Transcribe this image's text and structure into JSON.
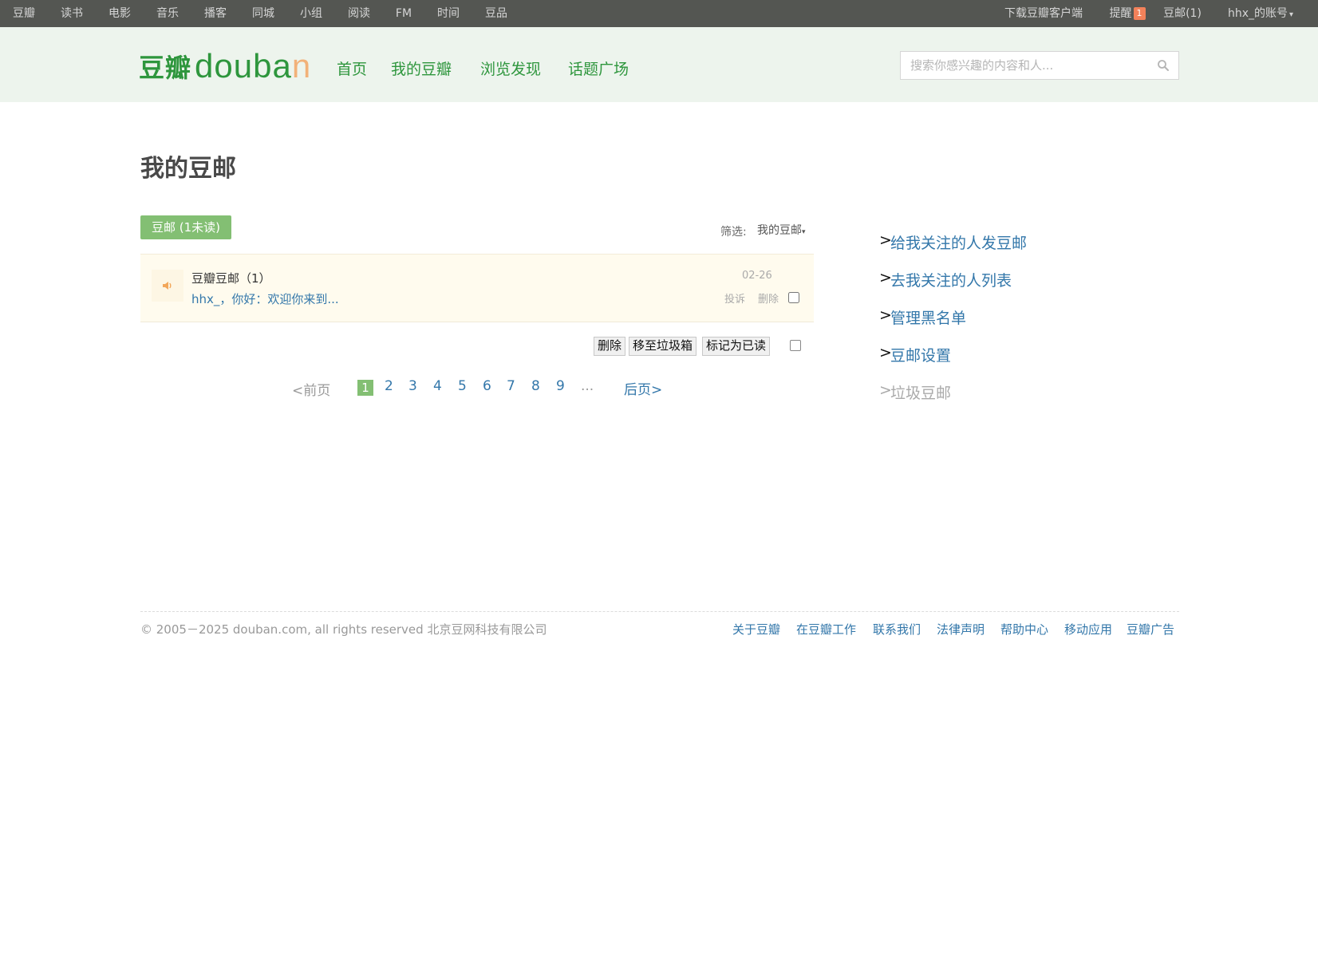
{
  "global_nav": {
    "items": [
      "豆瓣",
      "读书",
      "电影",
      "音乐",
      "播客",
      "同城",
      "小组",
      "阅读",
      "FM",
      "时间",
      "豆品"
    ],
    "download": "下载豆瓣客户端",
    "remind": "提醒",
    "remind_badge": "1",
    "doumail": "豆邮",
    "doumail_count": "(1)",
    "account": "hhx_的账号"
  },
  "header": {
    "logo_cn": "豆瓣",
    "logo_en_main": "douba",
    "logo_en_accent": "n",
    "nav": [
      "首页",
      "我的豆瓣",
      "浏览发现",
      "话题广场"
    ],
    "search_placeholder": "搜索你感兴趣的内容和人..."
  },
  "main": {
    "title": "我的豆邮",
    "tab_active": "豆邮 (1未读)",
    "filter_label": "筛选:",
    "filter_value": "我的豆邮",
    "message": {
      "sender": "豆瓣豆邮（1）",
      "snippet": "hhx_，你好：欢迎你来到...",
      "date": "02-26",
      "report": "投诉",
      "delete": "删除"
    },
    "bulk_actions": [
      "删除",
      "移至垃圾箱",
      "标记为已读"
    ],
    "pagination": {
      "prev": "<前页",
      "current": "1",
      "pages": [
        "2",
        "3",
        "4",
        "5",
        "6",
        "7",
        "8",
        "9"
      ],
      "ellipsis": "...",
      "next": "后页>"
    }
  },
  "sidebar": {
    "links": [
      "给我关注的人发豆邮",
      "去我关注的人列表",
      "管理黑名单",
      "豆邮设置",
      "垃圾豆邮"
    ]
  },
  "footer": {
    "copyright": "© 2005－2025 douban.com, all rights reserved 北京豆网科技有限公司",
    "links": [
      "关于豆瓣",
      "在豆瓣工作",
      "联系我们",
      "法律声明",
      "帮助中心",
      "移动应用",
      "豆瓣广告"
    ]
  },
  "colors": {
    "brand_green": "#2e963d",
    "link_blue": "#3377aa",
    "top_bar": "#545652",
    "header_band": "#edf4ed",
    "active_tab": "#83bf73",
    "message_row": "#fffbee"
  }
}
